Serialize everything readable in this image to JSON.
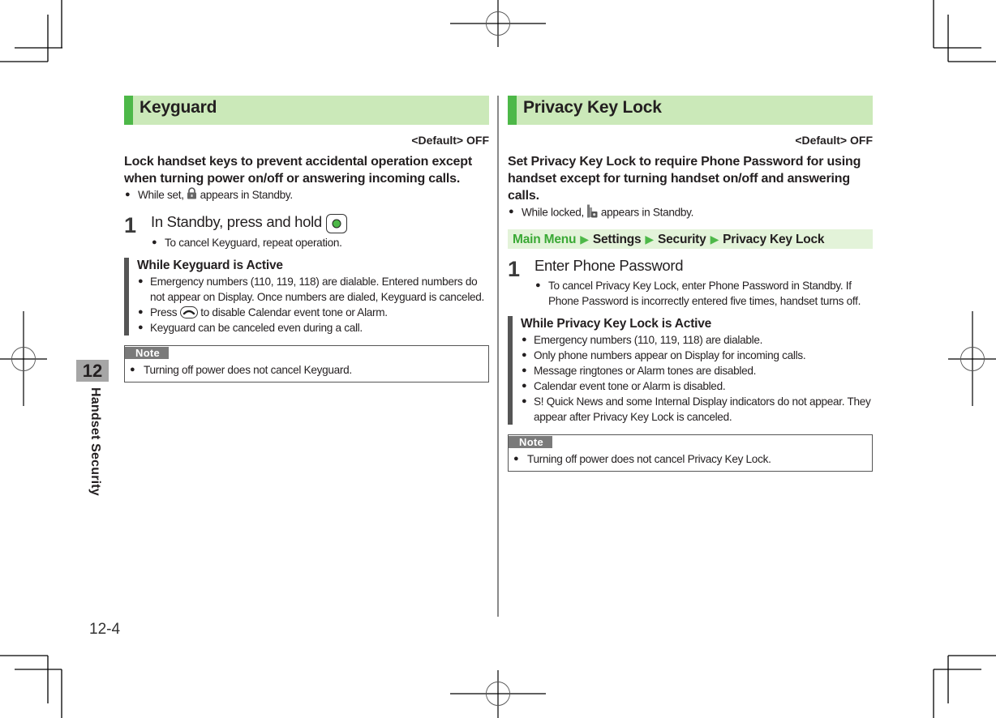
{
  "chapter": {
    "number": "12",
    "name": "Handset Security",
    "page_number": "12-4"
  },
  "keyguard": {
    "title": "Keyguard",
    "default": "<Default> OFF",
    "lead": "Lock handset keys to prevent accidental operation except when turning power on/off or answering incoming calls.",
    "intro_bullet": {
      "before": "While set, ",
      "icon": "keyguard-lock-icon",
      "after": " appears in Standby."
    },
    "step": {
      "number": "1",
      "text": "In Standby, press and hold ",
      "key_icon": "green-center-key-icon",
      "sub_bullets": [
        "To cancel Keyguard, repeat operation."
      ]
    },
    "active": {
      "heading": "While Keyguard is Active",
      "bullets": [
        "Emergency numbers (110, 119, 118) are dialable. Entered numbers do not appear on Display. Once numbers are dialed, Keyguard is canceled.",
        {
          "before": "Press ",
          "icon": "end-call-key-icon",
          "after": " to disable Calendar event tone or Alarm."
        },
        "Keyguard can be canceled even during a call."
      ]
    },
    "note": {
      "label": "Note",
      "bullets": [
        "Turning off power does not cancel Keyguard."
      ]
    }
  },
  "privacy": {
    "title": "Privacy Key Lock",
    "default": "<Default> OFF",
    "lead": "Set Privacy Key Lock to require Phone Password for using handset except for turning handset on/off and answering calls.",
    "intro_bullet": {
      "before": "While locked, ",
      "icon": "privacy-lock-icon",
      "after": " appears in Standby."
    },
    "menu_path": {
      "items": [
        "Main Menu",
        "Settings",
        "Security",
        "Privacy Key Lock"
      ],
      "separator": "▶"
    },
    "step": {
      "number": "1",
      "text": "Enter Phone Password",
      "sub_bullets": [
        "To cancel Privacy Key Lock, enter Phone Password in Standby. If Phone Password is incorrectly entered five times, handset turns off."
      ]
    },
    "active": {
      "heading": "While Privacy Key Lock is Active",
      "bullets": [
        "Emergency numbers (110, 119, 118) are dialable.",
        "Only phone numbers appear on Display for incoming calls.",
        "Message ringtones or Alarm tones are disabled.",
        "Calendar event tone or Alarm is disabled.",
        "S! Quick News and some Internal Display indicators do not appear. They appear after Privacy Key Lock is canceled."
      ]
    },
    "note": {
      "label": "Note",
      "bullets": [
        "Turning off power does not cancel Privacy Key Lock."
      ]
    }
  },
  "colors": {
    "section_header_bg": "#cbe9b9",
    "section_accent": "#4db848",
    "menu_path_bg": "#e3f3d9",
    "note_tab_bg": "#7a7a7a",
    "chapter_tab_bg": "#a6a6a6"
  },
  "bullet_glyph": "●"
}
